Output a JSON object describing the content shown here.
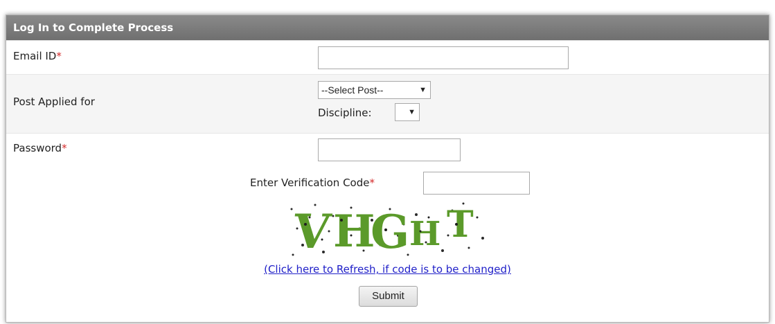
{
  "form": {
    "title": "Log In to Complete Process",
    "required_mark": "*",
    "email": {
      "label": "Email ID",
      "value": ""
    },
    "post": {
      "label": "Post Applied for",
      "select_value": "--Select Post--",
      "discipline_label": "Discipline:",
      "discipline_value": ""
    },
    "password": {
      "label": "Password",
      "value": ""
    },
    "verification": {
      "label": "Enter Verification Code",
      "value": "",
      "captcha_text": "VHGHT",
      "refresh_link": "(Click here to Refresh, if code is to be changed)"
    },
    "submit_label": "Submit"
  },
  "colors": {
    "header_bg": "#7b7b7b",
    "required": "#d42a2a",
    "captcha_green": "#5b9a2a",
    "link": "#2020c8"
  }
}
